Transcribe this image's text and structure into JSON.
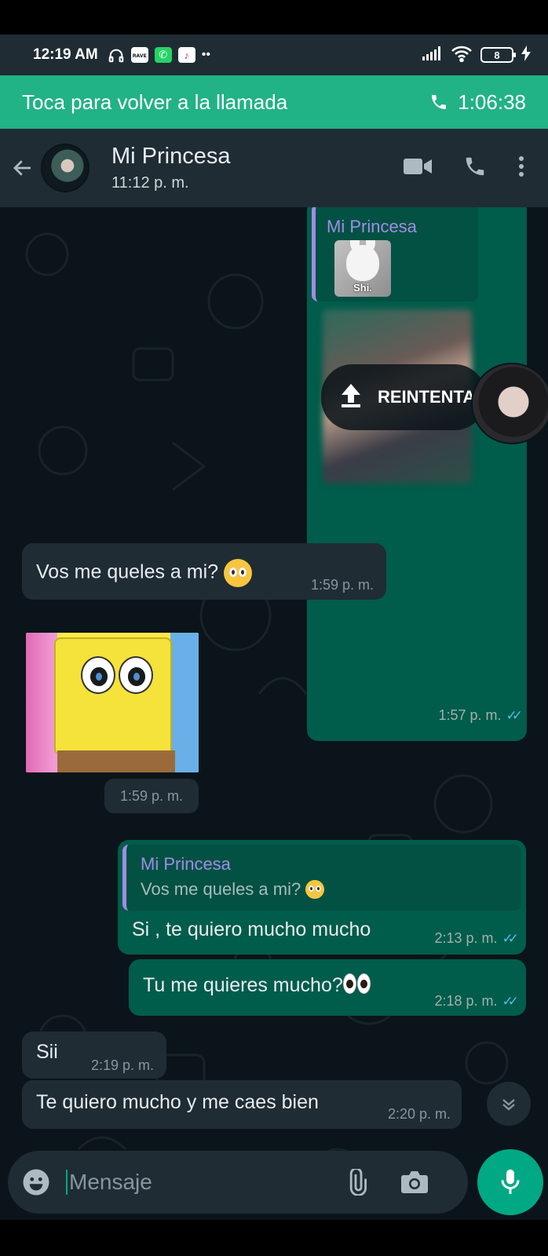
{
  "status_bar": {
    "time": "12:19 AM",
    "battery": "8",
    "carrier_badge": "ʀᴀᴠᴇ",
    "dots": "••"
  },
  "call_banner": {
    "text": "Toca para volver a la llamada",
    "duration": "1:06:38"
  },
  "header": {
    "contact_name": "Mi Princesa",
    "subtitle": "11:12 p. m."
  },
  "messages": {
    "m1": {
      "quote_name": "Mi Princesa",
      "sticker_caption": "Shi.",
      "retry_label": "REINTENTAR",
      "time": "1:57 p. m."
    },
    "m2": {
      "text": "Vos me queles a mi?",
      "time": "1:59 p. m."
    },
    "m3": {
      "time": "1:59 p. m."
    },
    "m4": {
      "quote_name": "Mi Princesa",
      "quote_text": "Vos me queles a mi?",
      "text": "Si , te quiero mucho mucho",
      "time": "2:13 p. m."
    },
    "m5": {
      "text": "Tu me quieres mucho?",
      "time": "2:18 p. m."
    },
    "m6": {
      "text": "Sii",
      "time": "2:19 p. m."
    },
    "m7": {
      "text": "Te quiero mucho y me caes bien",
      "time": "2:20 p. m."
    }
  },
  "composer": {
    "placeholder": "Mensaje"
  },
  "colors": {
    "accent": "#00a884",
    "call_banner": "#21b286",
    "outgoing_bubble": "#005c4b",
    "incoming_bubble": "#1f2c34",
    "read_ticks": "#53bdeb",
    "quote_name": "#a08ce5"
  },
  "icons": [
    "back-arrow-icon",
    "video-call-icon",
    "phone-icon",
    "more-options-icon",
    "emoji-icon",
    "attach-icon",
    "camera-icon",
    "mic-icon",
    "scroll-down-icon",
    "upload-icon"
  ]
}
